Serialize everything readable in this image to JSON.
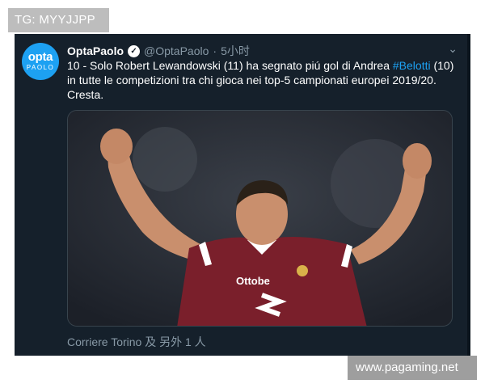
{
  "watermark_top": "TG: MYYJJPP",
  "watermark_bottom": "www.pagaming.net",
  "tweet": {
    "avatar": {
      "line1": "opta",
      "line2": "PAOLO"
    },
    "author_name": "OptaPaolo",
    "handle": "@OptaPaolo",
    "separator": "·",
    "time": "5小时",
    "text_before": "10 - Solo Robert Lewandowski (11) ha segnato piú gol di Andrea ",
    "hashtag": "#Belotti",
    "text_after": " (10) in tutte le competizioni tra chi gioca nei top-5 campionati europei 2019/20. Cresta.",
    "photo_caption": "Corriere Torino 及 另外 1 人",
    "jersey_sponsor": "Ottobe"
  },
  "colors": {
    "tweet_bg": "#15202b",
    "link": "#1da1f2",
    "secondary_text": "#8899a6",
    "jersey": "#7a1f2b"
  }
}
